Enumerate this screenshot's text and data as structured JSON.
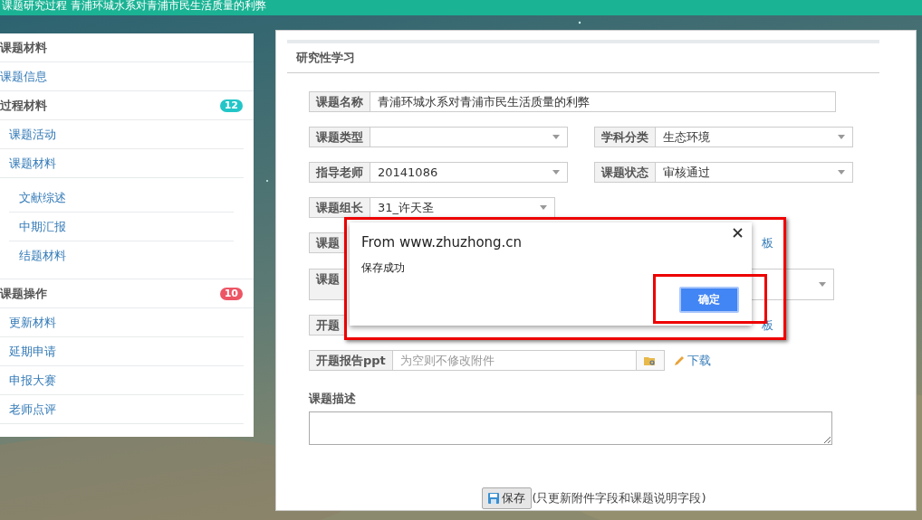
{
  "header": {
    "title": "课题研究过程 青浦环城水系对青浦市民生活质量的利弊"
  },
  "sidebar": {
    "sections": [
      {
        "title": "课题材料",
        "items": [
          {
            "label": "课题信息"
          }
        ]
      },
      {
        "title": "过程材料",
        "badge": {
          "text": "12",
          "color": "#23c6c8"
        },
        "items": [
          {
            "label": "课题活动"
          },
          {
            "label": "课题材料",
            "children": [
              {
                "label": "文献综述"
              },
              {
                "label": "中期汇报"
              },
              {
                "label": "结题材料"
              }
            ]
          }
        ]
      },
      {
        "title": "课题操作",
        "badge": {
          "text": "10",
          "color": "#ed5565"
        },
        "items": [
          {
            "label": "更新材料"
          },
          {
            "label": "延期申请"
          },
          {
            "label": "申报大赛"
          },
          {
            "label": "老师点评"
          }
        ]
      }
    ]
  },
  "panel": {
    "title": "研究性学习",
    "rows": [
      {
        "kind": "text",
        "fields": [
          {
            "label": "课题名称",
            "value": "青浦环城水系对青浦市民生活质量的利弊"
          }
        ]
      },
      {
        "kind": "select",
        "fields": [
          {
            "label": "课题类型"
          },
          {
            "label": "学科分类",
            "value": "生态环境"
          }
        ]
      },
      {
        "kind": "select",
        "fields": [
          {
            "label": "指导老师",
            "value": "20141086"
          },
          {
            "label": "课题状态",
            "value": "审核通过"
          }
        ]
      },
      {
        "kind": "short-select",
        "fields": [
          {
            "label": "课题组长",
            "value": "31_许天圣"
          }
        ]
      },
      {
        "kind": "covered",
        "fields": [
          {
            "label": "课题"
          }
        ],
        "link": "板"
      },
      {
        "kind": "covered-tall",
        "fields": [
          {
            "label": "课题"
          }
        ]
      },
      {
        "kind": "covered",
        "fields": [
          {
            "label": "开题"
          }
        ],
        "link": "板"
      },
      {
        "kind": "file",
        "fields": [
          {
            "label": "开题报告ppt",
            "placeholder": "为空则不修改附件"
          }
        ],
        "link": "下载"
      }
    ],
    "description_label": "课题描述",
    "save_button": "保存",
    "save_note": "(只更新附件字段和课题说明字段)"
  },
  "dialog": {
    "title": "From www.zhuzhong.cn",
    "message": "保存成功",
    "ok_button": "确定"
  }
}
